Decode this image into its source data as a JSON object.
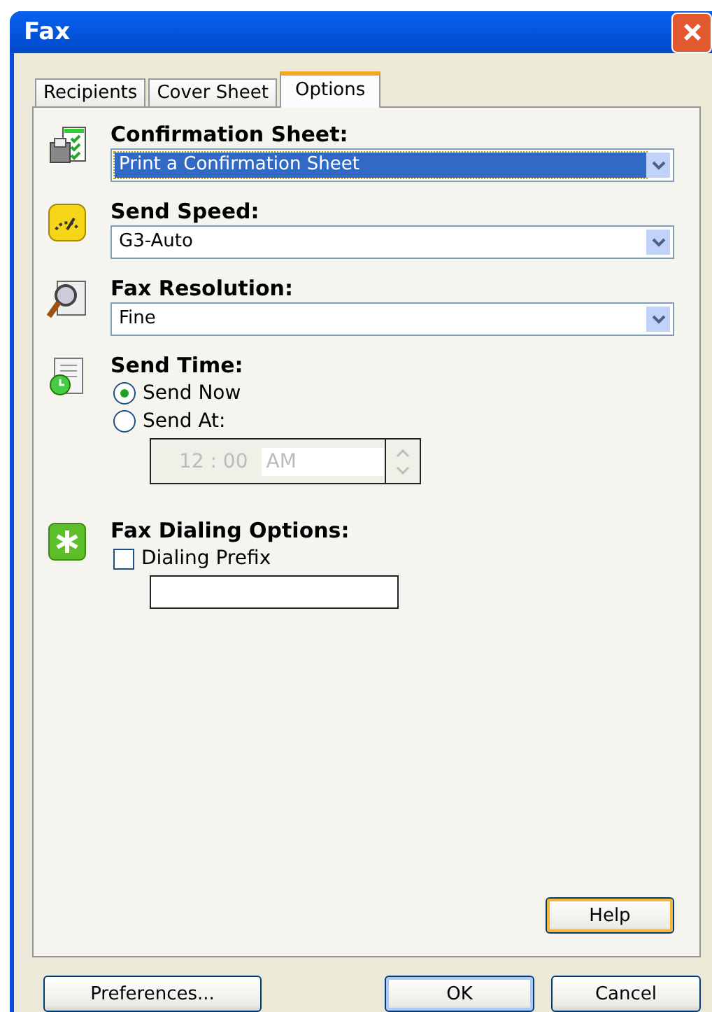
{
  "window": {
    "title": "Fax"
  },
  "tabs": [
    {
      "label": "Recipients",
      "selected": false
    },
    {
      "label": "Cover Sheet",
      "selected": false
    },
    {
      "label": "Options",
      "selected": true
    }
  ],
  "sections": [
    {
      "kind": "dropdown",
      "label": "Confirmation Sheet:",
      "value": "Print a Confirmation Sheet",
      "focused": true
    },
    {
      "kind": "dropdown",
      "label": "Send Speed:",
      "value": "G3-Auto",
      "focused": false
    },
    {
      "kind": "dropdown",
      "label": "Fax Resolution:",
      "value": "Fine",
      "focused": false
    },
    {
      "kind": "radios",
      "label": "Send Time:",
      "options": [
        {
          "label": "Send Now",
          "selected": true
        },
        {
          "label": "Send At:",
          "selected": false
        }
      ],
      "time": {
        "hour": "12",
        "separator": ":",
        "minute": "00",
        "ampm": "AM",
        "disabled": true
      }
    },
    {
      "kind": "checkbox",
      "label": "Fax Dialing Options:",
      "option": {
        "label": "Dialing Prefix",
        "checked": false
      }
    }
  ],
  "help_button": "Help",
  "buttons": [
    {
      "label": "Preferences...",
      "default": false
    },
    {
      "label": "OK",
      "default": true
    },
    {
      "label": "Cancel",
      "default": false
    }
  ]
}
